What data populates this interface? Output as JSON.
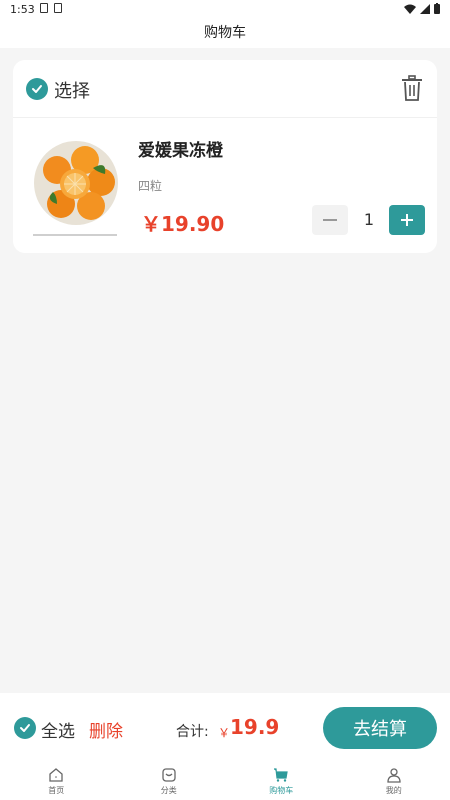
{
  "status_bar": {
    "time": "1:53"
  },
  "header": {
    "title": "购物车"
  },
  "cart": {
    "select_label": "选择",
    "item": {
      "name": "爱媛果冻橙",
      "spec": "四粒",
      "price": "￥19.90",
      "quantity": "1"
    }
  },
  "checkout": {
    "select_all_label": "全选",
    "delete_label": "删除",
    "total_label": "合计:",
    "currency": "￥",
    "total_value": "19.9",
    "button_label": "去结算"
  },
  "tabbar": {
    "items": [
      {
        "label": "首页",
        "icon": "home-icon"
      },
      {
        "label": "分类",
        "icon": "category-icon"
      },
      {
        "label": "购物车",
        "icon": "cart-icon"
      },
      {
        "label": "我的",
        "icon": "user-icon"
      }
    ],
    "active_index": 2
  },
  "colors": {
    "accent": "#2e9a9a",
    "price": "#e8422b"
  }
}
